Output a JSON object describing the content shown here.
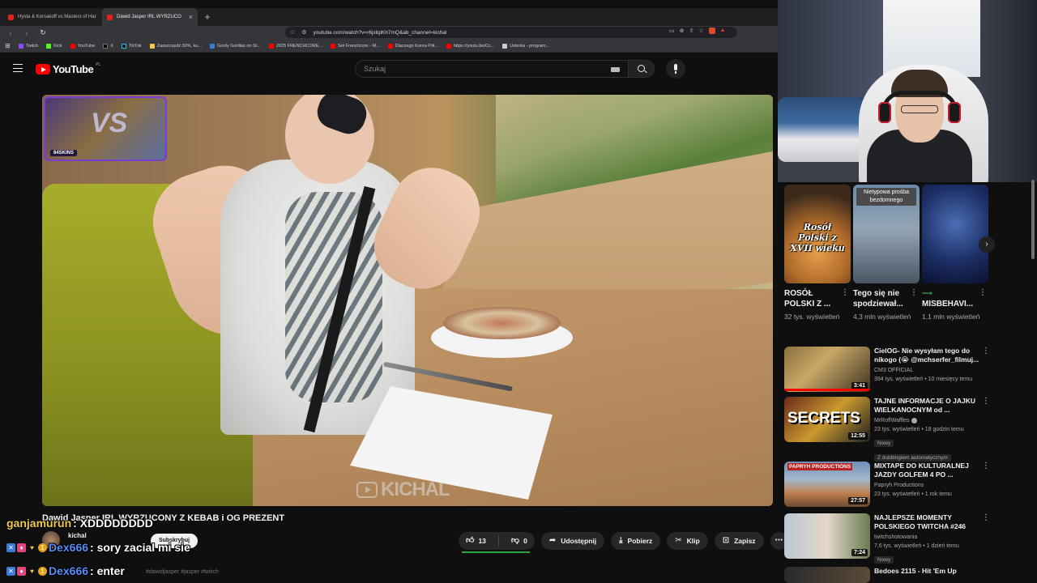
{
  "browser": {
    "tabs": [
      {
        "label": "Hysta & Korsakoff vs Masters of Har",
        "active": false
      },
      {
        "label": "Dawid Jasper IRL WYRZUCO",
        "active": true
      }
    ],
    "new_tab": "+",
    "url": "youtube.com/watch?v=r6jxbpKh7mQ&ab_channel=kichal",
    "bookmarks": [
      "Twitch",
      "Kick",
      "YouTube",
      "X",
      "TikTok",
      "Zaoszczędź 30%, ku...",
      "Goofy Gorillas on St...",
      "2025 FRENCHCORE...",
      "Set Frenchcore - M...",
      "Dlaczego Korea Pół...",
      "https://youtu.be/Cc...",
      "Usterka - program..."
    ]
  },
  "youtube": {
    "logo": "YouTube",
    "country": "PL",
    "search_placeholder": "Szukaj"
  },
  "video": {
    "overlay_text": "VS",
    "overlay_badge": "84SKINS",
    "watermark": "KICHAL",
    "title": "Dawid Jasper IRL WYRZUCONY Z KEBAB i OG PREZENT",
    "channel": "kichal",
    "subscribe_label": "Subskrybuj",
    "likes": "13",
    "dislikes": "0",
    "share_label": "Udostępnij",
    "download_label": "Pobierz",
    "clip_label": "Klip",
    "save_label": "Zapisz",
    "hashtags": "#dawidjasper #jasper #twitch"
  },
  "chat": [
    {
      "user": "ganjamurun",
      "message": ": XDDDDDDDD",
      "color": "#f2c94c"
    },
    {
      "user": "Dex666",
      "message": ": sory zacial mi sie",
      "color": "#5b8cf5"
    },
    {
      "user": "Dex666",
      "message": ": enter",
      "color": "#5b8cf5"
    }
  ],
  "shorts": [
    {
      "title": "ROSÓŁ POLSKI Z ...",
      "views": "32 tys. wyświetleń",
      "overlay": "Rosół Polski z XVII wieku"
    },
    {
      "title": "Tego się nie spodziewał...",
      "views": "4,3 mln wyświetleń",
      "badge": "Nietypowa prośba bezdomnego"
    },
    {
      "title": "MISBEHAVI...",
      "views": "1,1 mln wyświetleń"
    }
  ],
  "recommended": [
    {
      "title": "CielOG- Nie wysyłam tego do nikogo (😭 @mchserfer_filmuj...",
      "channel": "CM3 OFFICIAL",
      "meta": "394 tys. wyświetleń • 10 miesięcy temu",
      "duration": "3:41"
    },
    {
      "title": "TAJNE INFORMACJE O JAJKU WIELKANOCNYM od ...",
      "channel": "MrRoflWaffles",
      "meta": "23 tys. wyświetleń • 18 godzin temu",
      "duration": "12:55",
      "thumb_text": "SECRETS",
      "tags": [
        "Nowy",
        "Z dubbingiem automatycznym"
      ]
    },
    {
      "title": "MIXTAPE DO KULTURALNEJ JAZDY GOLFEM 4 PO ...",
      "channel": "Papryh Productions",
      "meta": "23 tys. wyświetleń • 1 rok temu",
      "duration": "27:57",
      "thumb_text": "PAPRYH PRODUCTIONS"
    },
    {
      "title": "NAJLEPSZE MOMENTY POLSKIEGO TWITCHA #246",
      "channel": "twitchshotowania",
      "meta": "7,6 tys. wyświetleń • 1 dzień temu",
      "duration": "7:24",
      "tags": [
        "Nowy"
      ]
    },
    {
      "title": "Bedoes 2115 - Hit 'Em Up"
    }
  ],
  "colors": {
    "accent": "#ff0000",
    "like_bar": "#2ba640",
    "background": "#0f0f0f"
  }
}
